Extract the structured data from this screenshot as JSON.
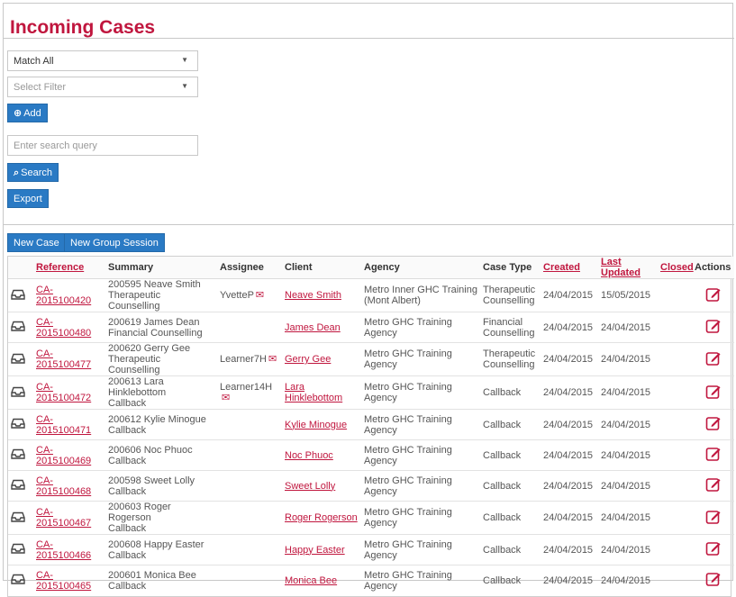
{
  "page": {
    "title": "Incoming Cases"
  },
  "filters": {
    "match_value": "Match All",
    "select_filter_placeholder": "Select Filter",
    "add_label": "Add",
    "search_placeholder": "Enter search query",
    "search_label": "Search",
    "export_label": "Export"
  },
  "toolbar": {
    "new_case_label": "New Case",
    "new_group_session_label": "New Group Session"
  },
  "table": {
    "columns": [
      "",
      "Reference",
      "Summary",
      "Assignee",
      "Client",
      "Agency",
      "Case Type",
      "Created",
      "Last Updated",
      "Closed",
      "Actions"
    ],
    "rows": [
      {
        "ref": "CA-2015100420",
        "summary1": "200595 Neave Smith",
        "summary2": "Therapeutic Counselling",
        "assignee": "YvetteP",
        "client": "Neave Smith",
        "agency1": "Metro Inner GHC Training",
        "agency2": "(Mont Albert)",
        "type1": "Therapeutic",
        "type2": "Counselling",
        "created": "24/04/2015",
        "updated": "15/05/2015"
      },
      {
        "ref": "CA-2015100480",
        "summary1": "200619 James Dean",
        "summary2": "Financial Counselling",
        "assignee": "",
        "client": "James Dean",
        "agency1": "Metro GHC Training Agency",
        "agency2": "",
        "type1": "Financial",
        "type2": "Counselling",
        "created": "24/04/2015",
        "updated": "24/04/2015"
      },
      {
        "ref": "CA-2015100477",
        "summary1": "200620 Gerry Gee",
        "summary2": "Therapeutic Counselling",
        "assignee": "Learner7H",
        "client": "Gerry Gee",
        "agency1": "Metro GHC Training Agency",
        "agency2": "",
        "type1": "Therapeutic",
        "type2": "Counselling",
        "created": "24/04/2015",
        "updated": "24/04/2015"
      },
      {
        "ref": "CA-2015100472",
        "summary1": "200613 Lara Hinklebottom",
        "summary2": "Callback",
        "assignee": "Learner14H",
        "client": "Lara Hinklebottom",
        "agency1": "Metro GHC Training Agency",
        "agency2": "",
        "type1": "Callback",
        "type2": "",
        "created": "24/04/2015",
        "updated": "24/04/2015"
      },
      {
        "ref": "CA-2015100471",
        "summary1": "200612 Kylie Minogue",
        "summary2": "Callback",
        "assignee": "",
        "client": "Kylie Minogue",
        "agency1": "Metro GHC Training Agency",
        "agency2": "",
        "type1": "Callback",
        "type2": "",
        "created": "24/04/2015",
        "updated": "24/04/2015"
      },
      {
        "ref": "CA-2015100469",
        "summary1": "200606 Noc Phuoc",
        "summary2": "Callback",
        "assignee": "",
        "client": "Noc Phuoc",
        "agency1": "Metro GHC Training Agency",
        "agency2": "",
        "type1": "Callback",
        "type2": "",
        "created": "24/04/2015",
        "updated": "24/04/2015"
      },
      {
        "ref": "CA-2015100468",
        "summary1": "200598 Sweet Lolly",
        "summary2": "Callback",
        "assignee": "",
        "client": "Sweet Lolly",
        "agency1": "Metro GHC Training Agency",
        "agency2": "",
        "type1": "Callback",
        "type2": "",
        "created": "24/04/2015",
        "updated": "24/04/2015"
      },
      {
        "ref": "CA-2015100467",
        "summary1": "200603 Roger Rogerson",
        "summary2": "Callback",
        "assignee": "",
        "client": "Roger Rogerson",
        "agency1": "Metro GHC Training Agency",
        "agency2": "",
        "type1": "Callback",
        "type2": "",
        "created": "24/04/2015",
        "updated": "24/04/2015"
      },
      {
        "ref": "CA-2015100466",
        "summary1": "200608 Happy Easter",
        "summary2": "Callback",
        "assignee": "",
        "client": "Happy Easter",
        "agency1": "Metro GHC Training Agency",
        "agency2": "",
        "type1": "Callback",
        "type2": "",
        "created": "24/04/2015",
        "updated": "24/04/2015"
      },
      {
        "ref": "CA-2015100465",
        "summary1": "200601 Monica Bee",
        "summary2": "Callback",
        "assignee": "",
        "client": "Monica Bee",
        "agency1": "Metro GHC Training Agency",
        "agency2": "",
        "type1": "Callback",
        "type2": "",
        "created": "24/04/2015",
        "updated": "24/04/2015"
      }
    ]
  },
  "icons": {
    "row_icon": "inbox-icon",
    "edit_icon": "edit-icon",
    "mail_icon": "mail-icon"
  },
  "colors": {
    "accent": "#c0163e",
    "button": "#2a7ac4"
  }
}
